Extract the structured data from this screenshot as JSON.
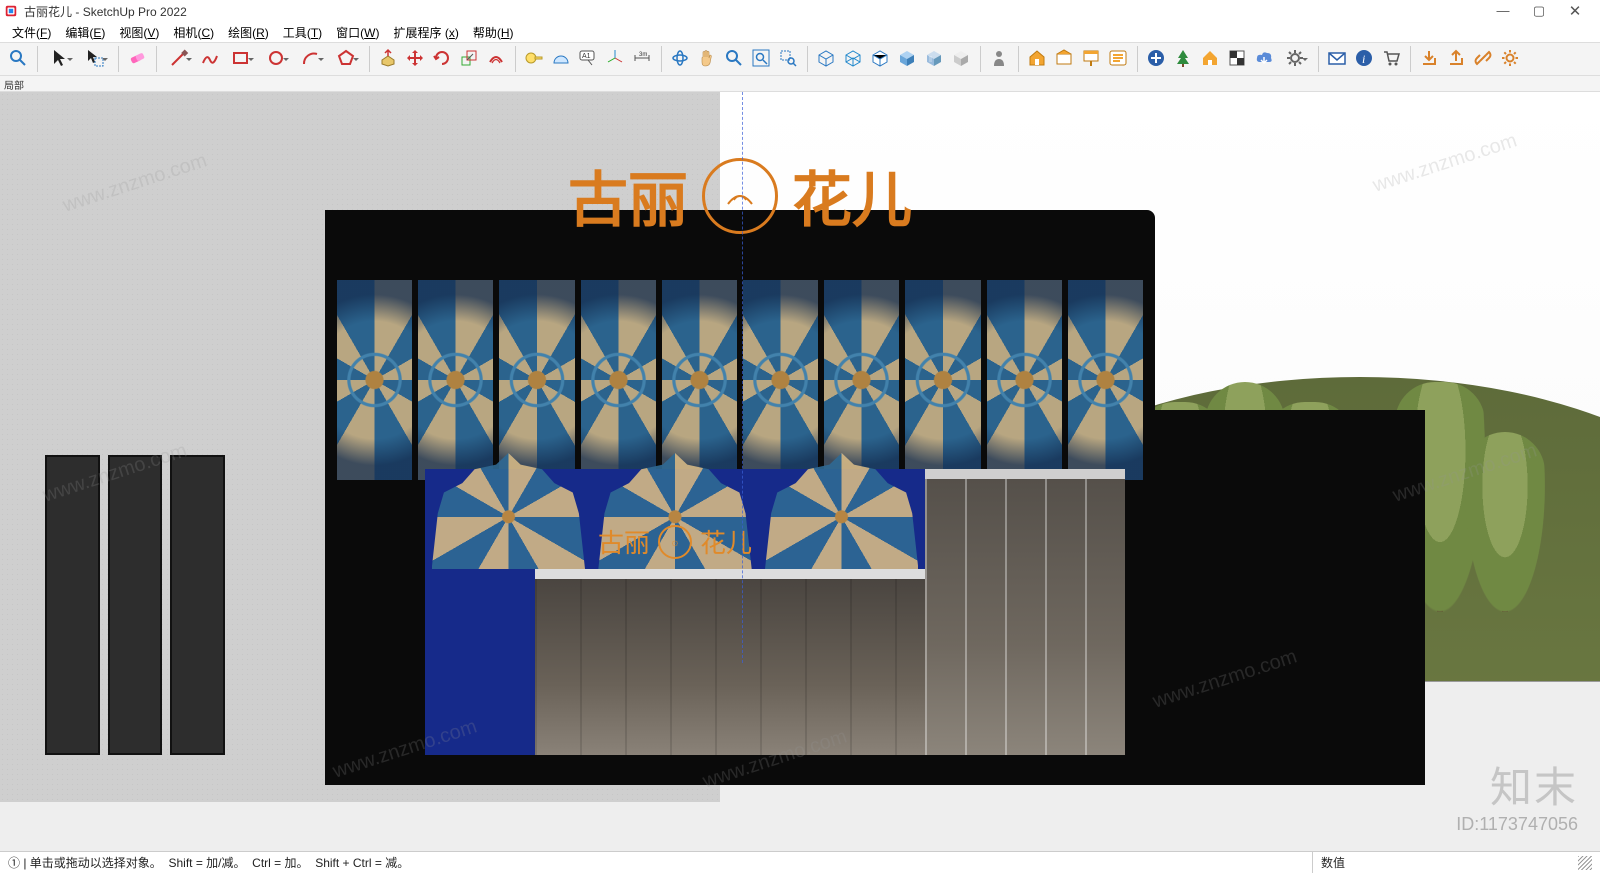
{
  "title": {
    "document_name": "古丽花儿",
    "app_name": "SketchUp Pro 2022"
  },
  "window_controls": {
    "minimize": "—",
    "maximize": "▢",
    "close": "✕"
  },
  "menu": {
    "file": {
      "label": "文件",
      "hotkey": "F"
    },
    "edit": {
      "label": "编辑",
      "hotkey": "E"
    },
    "view": {
      "label": "视图",
      "hotkey": "V"
    },
    "camera": {
      "label": "相机",
      "hotkey": "C"
    },
    "draw": {
      "label": "绘图",
      "hotkey": "R"
    },
    "tools": {
      "label": "工具",
      "hotkey": "T"
    },
    "window": {
      "label": "窗口",
      "hotkey": "W"
    },
    "ext": {
      "label": "扩展程序",
      "hotkey": "x"
    },
    "help": {
      "label": "帮助",
      "hotkey": "H"
    }
  },
  "desc_bar": {
    "label": "局部"
  },
  "toolbar": {
    "groups": [
      [
        "search-icon"
      ],
      [
        "select-icon",
        "select-window-icon"
      ],
      [
        "eraser-icon"
      ],
      [
        "line-icon",
        "freehand-icon",
        "rectangle-icon",
        "circle-icon",
        "arc-icon",
        "polygon-icon"
      ],
      [
        "pushpull-icon",
        "move-icon",
        "rotate-icon",
        "scale-icon",
        "offset-icon"
      ],
      [
        "tape-icon",
        "protractor-icon",
        "text-icon",
        "axis-icon",
        "dimension-icon"
      ],
      [
        "orbit-icon",
        "pan-icon",
        "zoom-icon",
        "zoom-extents-icon",
        "zoom-window-icon"
      ],
      [
        "xray-icon",
        "wireframe-icon",
        "hidden-line-icon",
        "shaded-icon",
        "shaded-tex-icon",
        "mono-icon"
      ],
      [
        "person-icon"
      ],
      [
        "warehouse-icon",
        "components-icon",
        "paint-icon",
        "outliner-icon"
      ],
      [
        "add-icon",
        "tree-icon",
        "house-icon",
        "checker-icon",
        "cloud-icon",
        "gear-icon"
      ],
      [
        "mail-icon",
        "info-icon",
        "cart-icon"
      ],
      [
        "import-icon",
        "export-icon",
        "link-icon",
        "settings-icon"
      ]
    ]
  },
  "scene": {
    "sign_top_left": "古丽",
    "sign_top_right": "花儿",
    "sign_small_left": "古丽",
    "sign_small_right": "花儿",
    "upper_panel_count": 10,
    "arch_count": 3
  },
  "watermarks": {
    "url": "www.znzmo.com",
    "brand": "知末",
    "id_label": "ID:1173747056"
  },
  "status": {
    "hint_left_a": "① | 单击或拖动以选择对象。",
    "hint_left_b": "Shift = 加/减。",
    "hint_left_c": "Ctrl = 加。",
    "hint_left_d": "Shift + Ctrl = 减。",
    "value_label": "数值"
  }
}
